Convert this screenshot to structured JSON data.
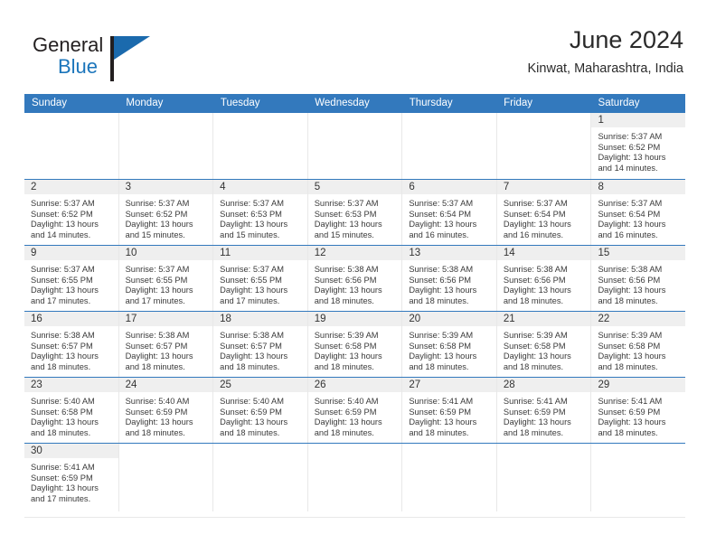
{
  "brand": {
    "name_part1": "General",
    "name_part2": "Blue",
    "logo_icon": "blue-triangle-flag-icon"
  },
  "header": {
    "title": "June 2024",
    "subtitle": "Kinwat, Maharashtra, India"
  },
  "calendar": {
    "accent_color": "#3379bd",
    "daynum_band_color": "#efefef",
    "weekdays": [
      "Sunday",
      "Monday",
      "Tuesday",
      "Wednesday",
      "Thursday",
      "Friday",
      "Saturday"
    ],
    "weeks": [
      [
        {
          "empty": true
        },
        {
          "empty": true
        },
        {
          "empty": true
        },
        {
          "empty": true
        },
        {
          "empty": true
        },
        {
          "empty": true
        },
        {
          "day": "1",
          "sunrise": "Sunrise: 5:37 AM",
          "sunset": "Sunset: 6:52 PM",
          "daylight1": "Daylight: 13 hours",
          "daylight2": "and 14 minutes."
        }
      ],
      [
        {
          "day": "2",
          "sunrise": "Sunrise: 5:37 AM",
          "sunset": "Sunset: 6:52 PM",
          "daylight1": "Daylight: 13 hours",
          "daylight2": "and 14 minutes."
        },
        {
          "day": "3",
          "sunrise": "Sunrise: 5:37 AM",
          "sunset": "Sunset: 6:52 PM",
          "daylight1": "Daylight: 13 hours",
          "daylight2": "and 15 minutes."
        },
        {
          "day": "4",
          "sunrise": "Sunrise: 5:37 AM",
          "sunset": "Sunset: 6:53 PM",
          "daylight1": "Daylight: 13 hours",
          "daylight2": "and 15 minutes."
        },
        {
          "day": "5",
          "sunrise": "Sunrise: 5:37 AM",
          "sunset": "Sunset: 6:53 PM",
          "daylight1": "Daylight: 13 hours",
          "daylight2": "and 15 minutes."
        },
        {
          "day": "6",
          "sunrise": "Sunrise: 5:37 AM",
          "sunset": "Sunset: 6:54 PM",
          "daylight1": "Daylight: 13 hours",
          "daylight2": "and 16 minutes."
        },
        {
          "day": "7",
          "sunrise": "Sunrise: 5:37 AM",
          "sunset": "Sunset: 6:54 PM",
          "daylight1": "Daylight: 13 hours",
          "daylight2": "and 16 minutes."
        },
        {
          "day": "8",
          "sunrise": "Sunrise: 5:37 AM",
          "sunset": "Sunset: 6:54 PM",
          "daylight1": "Daylight: 13 hours",
          "daylight2": "and 16 minutes."
        }
      ],
      [
        {
          "day": "9",
          "sunrise": "Sunrise: 5:37 AM",
          "sunset": "Sunset: 6:55 PM",
          "daylight1": "Daylight: 13 hours",
          "daylight2": "and 17 minutes."
        },
        {
          "day": "10",
          "sunrise": "Sunrise: 5:37 AM",
          "sunset": "Sunset: 6:55 PM",
          "daylight1": "Daylight: 13 hours",
          "daylight2": "and 17 minutes."
        },
        {
          "day": "11",
          "sunrise": "Sunrise: 5:37 AM",
          "sunset": "Sunset: 6:55 PM",
          "daylight1": "Daylight: 13 hours",
          "daylight2": "and 17 minutes."
        },
        {
          "day": "12",
          "sunrise": "Sunrise: 5:38 AM",
          "sunset": "Sunset: 6:56 PM",
          "daylight1": "Daylight: 13 hours",
          "daylight2": "and 18 minutes."
        },
        {
          "day": "13",
          "sunrise": "Sunrise: 5:38 AM",
          "sunset": "Sunset: 6:56 PM",
          "daylight1": "Daylight: 13 hours",
          "daylight2": "and 18 minutes."
        },
        {
          "day": "14",
          "sunrise": "Sunrise: 5:38 AM",
          "sunset": "Sunset: 6:56 PM",
          "daylight1": "Daylight: 13 hours",
          "daylight2": "and 18 minutes."
        },
        {
          "day": "15",
          "sunrise": "Sunrise: 5:38 AM",
          "sunset": "Sunset: 6:56 PM",
          "daylight1": "Daylight: 13 hours",
          "daylight2": "and 18 minutes."
        }
      ],
      [
        {
          "day": "16",
          "sunrise": "Sunrise: 5:38 AM",
          "sunset": "Sunset: 6:57 PM",
          "daylight1": "Daylight: 13 hours",
          "daylight2": "and 18 minutes."
        },
        {
          "day": "17",
          "sunrise": "Sunrise: 5:38 AM",
          "sunset": "Sunset: 6:57 PM",
          "daylight1": "Daylight: 13 hours",
          "daylight2": "and 18 minutes."
        },
        {
          "day": "18",
          "sunrise": "Sunrise: 5:38 AM",
          "sunset": "Sunset: 6:57 PM",
          "daylight1": "Daylight: 13 hours",
          "daylight2": "and 18 minutes."
        },
        {
          "day": "19",
          "sunrise": "Sunrise: 5:39 AM",
          "sunset": "Sunset: 6:58 PM",
          "daylight1": "Daylight: 13 hours",
          "daylight2": "and 18 minutes."
        },
        {
          "day": "20",
          "sunrise": "Sunrise: 5:39 AM",
          "sunset": "Sunset: 6:58 PM",
          "daylight1": "Daylight: 13 hours",
          "daylight2": "and 18 minutes."
        },
        {
          "day": "21",
          "sunrise": "Sunrise: 5:39 AM",
          "sunset": "Sunset: 6:58 PM",
          "daylight1": "Daylight: 13 hours",
          "daylight2": "and 18 minutes."
        },
        {
          "day": "22",
          "sunrise": "Sunrise: 5:39 AM",
          "sunset": "Sunset: 6:58 PM",
          "daylight1": "Daylight: 13 hours",
          "daylight2": "and 18 minutes."
        }
      ],
      [
        {
          "day": "23",
          "sunrise": "Sunrise: 5:40 AM",
          "sunset": "Sunset: 6:58 PM",
          "daylight1": "Daylight: 13 hours",
          "daylight2": "and 18 minutes."
        },
        {
          "day": "24",
          "sunrise": "Sunrise: 5:40 AM",
          "sunset": "Sunset: 6:59 PM",
          "daylight1": "Daylight: 13 hours",
          "daylight2": "and 18 minutes."
        },
        {
          "day": "25",
          "sunrise": "Sunrise: 5:40 AM",
          "sunset": "Sunset: 6:59 PM",
          "daylight1": "Daylight: 13 hours",
          "daylight2": "and 18 minutes."
        },
        {
          "day": "26",
          "sunrise": "Sunrise: 5:40 AM",
          "sunset": "Sunset: 6:59 PM",
          "daylight1": "Daylight: 13 hours",
          "daylight2": "and 18 minutes."
        },
        {
          "day": "27",
          "sunrise": "Sunrise: 5:41 AM",
          "sunset": "Sunset: 6:59 PM",
          "daylight1": "Daylight: 13 hours",
          "daylight2": "and 18 minutes."
        },
        {
          "day": "28",
          "sunrise": "Sunrise: 5:41 AM",
          "sunset": "Sunset: 6:59 PM",
          "daylight1": "Daylight: 13 hours",
          "daylight2": "and 18 minutes."
        },
        {
          "day": "29",
          "sunrise": "Sunrise: 5:41 AM",
          "sunset": "Sunset: 6:59 PM",
          "daylight1": "Daylight: 13 hours",
          "daylight2": "and 18 minutes."
        }
      ],
      [
        {
          "day": "30",
          "sunrise": "Sunrise: 5:41 AM",
          "sunset": "Sunset: 6:59 PM",
          "daylight1": "Daylight: 13 hours",
          "daylight2": "and 17 minutes."
        },
        {
          "empty": true
        },
        {
          "empty": true
        },
        {
          "empty": true
        },
        {
          "empty": true
        },
        {
          "empty": true
        },
        {
          "empty": true
        }
      ]
    ]
  }
}
